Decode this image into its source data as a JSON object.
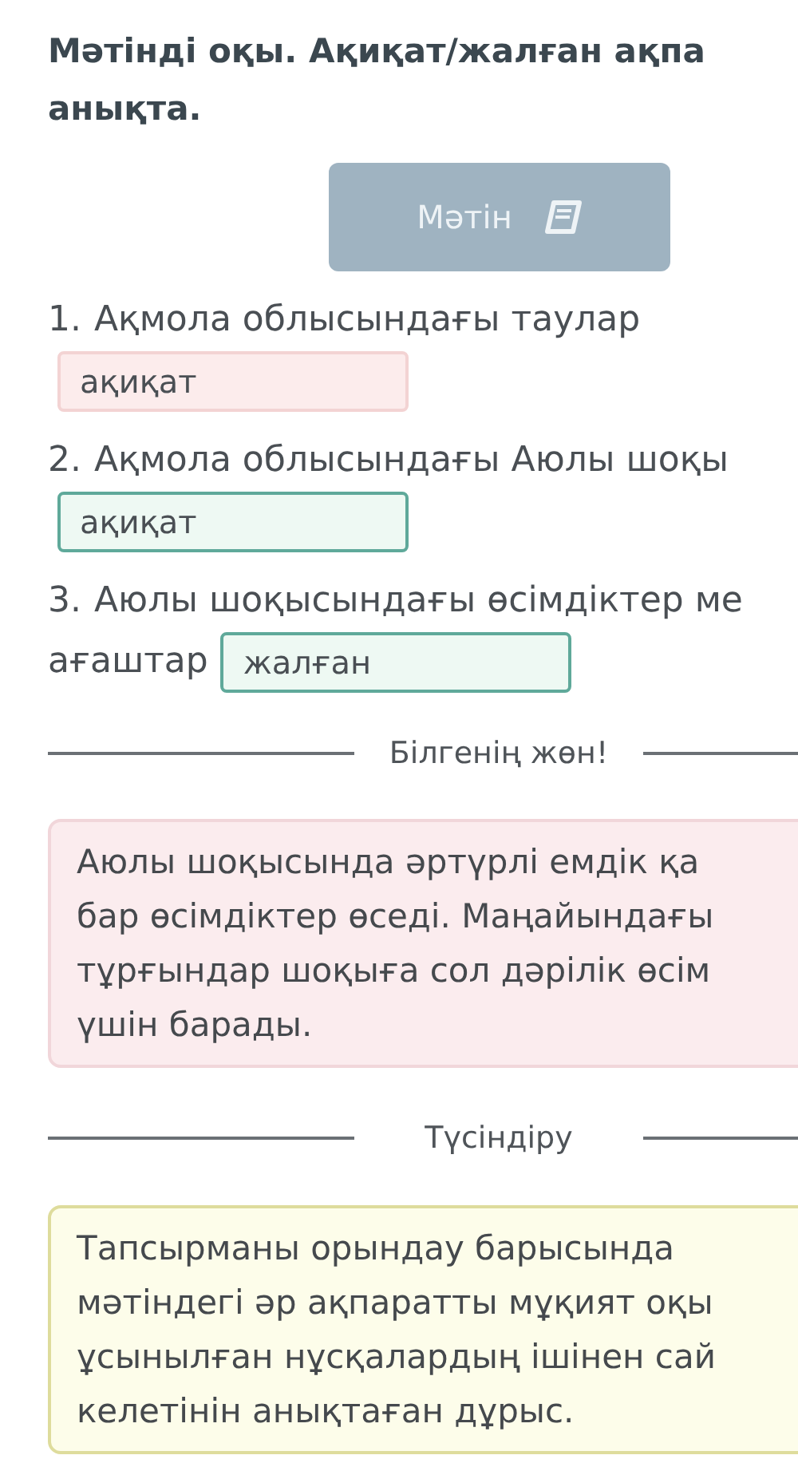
{
  "title_lines": [
    "Мәтінді оқы. Ақиқат/жалған ақпа",
    "анықта."
  ],
  "text_button": {
    "label": "Мәтін"
  },
  "questions": [
    {
      "number": "1.",
      "lines": [
        "Ақмола облысындағы таулар"
      ],
      "answer": "ақиқат",
      "correct": false
    },
    {
      "number": "2.",
      "lines": [
        "Ақмола облысындағы Аюлы шоқы"
      ],
      "answer": "ақиқат",
      "correct": true
    },
    {
      "number": "3.",
      "lines": [
        "Аюлы шоқысындағы өсімдіктер ме",
        "ағаштар"
      ],
      "answer": "жалған",
      "correct": true
    }
  ],
  "sections": [
    {
      "heading": "Білгенің жөн!",
      "kind": "fact",
      "lines": [
        "Аюлы шоқысында әртүрлі емдік қа",
        "бар өсімдіктер өседі. Маңайындағы",
        "тұрғындар шоқыға сол дәрілік өсім",
        "үшін барады."
      ]
    },
    {
      "heading": "Түсіндіру",
      "kind": "explanation",
      "lines": [
        "Тапсырманы орындау барысында",
        "мәтіндегі әр ақпаратты мұқият оқы",
        "ұсынылған нұсқалардың ішінен сай",
        "келетінін анықтаған дұрыс."
      ]
    }
  ]
}
